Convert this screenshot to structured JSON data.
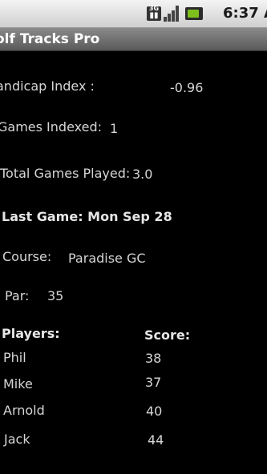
{
  "status_bar": {
    "network_badge": "3G",
    "icons": [
      "network-3g-icon",
      "signal-strength-icon",
      "battery-icon"
    ],
    "time": "6:37 A"
  },
  "app": {
    "title": "olf Tracks Pro"
  },
  "summary": {
    "handicap_label": "andicap Index :",
    "handicap_value": "-0.96",
    "games_indexed_label": "Games Indexed:",
    "games_indexed_value": "1",
    "total_games_label": "Total Games Played:",
    "total_games_value": "3.0"
  },
  "last_game": {
    "heading": "Last Game: Mon Sep 28",
    "course_label": "Course:",
    "course_value": "Paradise GC",
    "par_label": "Par:",
    "par_value": "35"
  },
  "scores": {
    "players_header": "Players:",
    "score_header": "Score:",
    "rows": [
      {
        "player": "Phil",
        "score": "38"
      },
      {
        "player": "Mike",
        "score": "37"
      },
      {
        "player": "Arnold",
        "score": "40"
      },
      {
        "player": "Jack",
        "score": "44"
      }
    ]
  }
}
